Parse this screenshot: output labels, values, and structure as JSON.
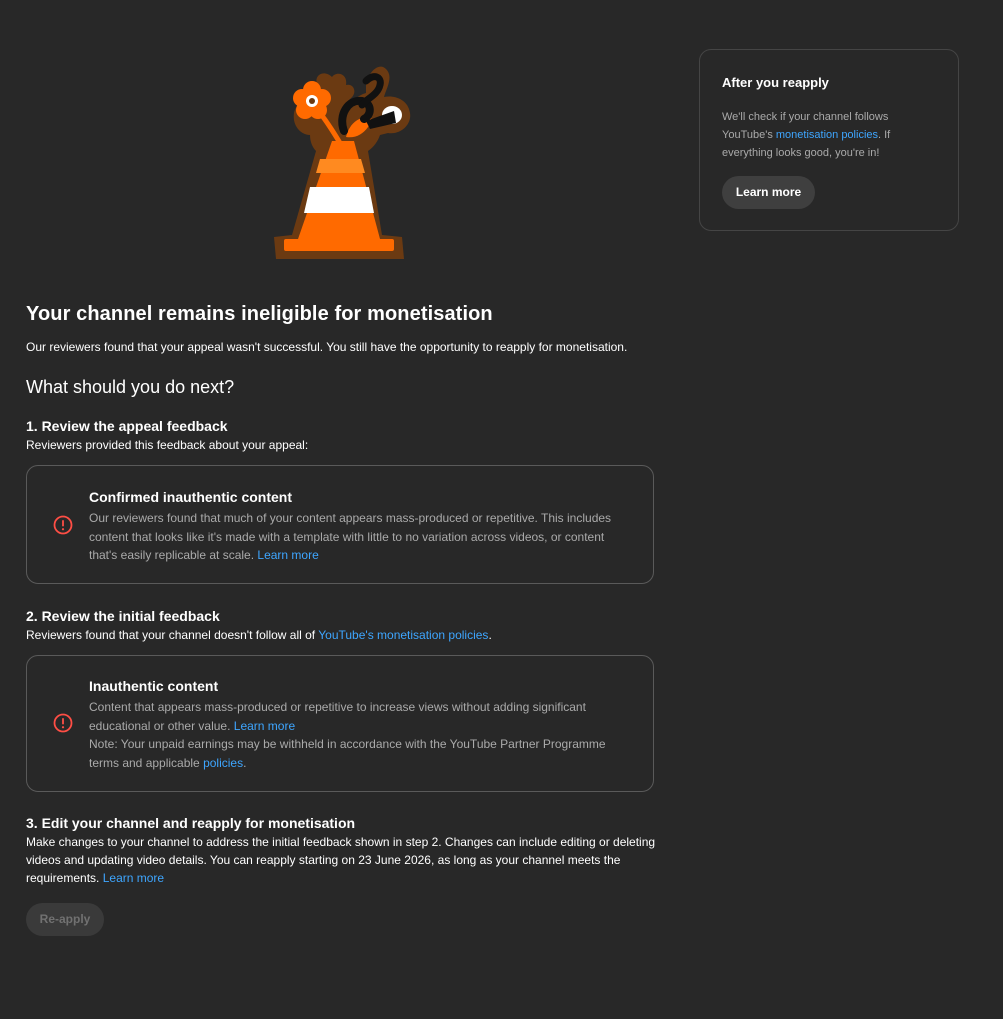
{
  "page": {
    "title": "Your channel remains ineligible for monetisation",
    "subtitle": "Our reviewers found that your appeal wasn't successful. You still have the opportunity to reapply for monetisation.",
    "next_heading": "What should you do next?"
  },
  "step1": {
    "title": "1. Review the appeal feedback",
    "desc": "Reviewers provided this feedback about your appeal:",
    "card": {
      "icon": "alert-circle-icon",
      "title": "Confirmed inauthentic content",
      "text": "Our reviewers found that much of your content appears mass-produced or repetitive. This includes content that looks like it's made with a template with little to no variation across videos, or content that's easily replicable at scale.",
      "link": "Learn more"
    }
  },
  "step2": {
    "title": "2. Review the initial feedback",
    "desc_prefix": "Reviewers found that your channel doesn't follow all of ",
    "desc_link": "YouTube's monetisation policies",
    "desc_suffix": ".",
    "card": {
      "icon": "alert-circle-icon",
      "title": "Inauthentic content",
      "text": "Content that appears mass-produced or repetitive to increase views without adding significant educational or other value.",
      "link": "Learn more",
      "note_prefix": "Note: Your unpaid earnings may be withheld in accordance with the YouTube Partner Programme terms and applicable ",
      "note_link": "policies",
      "note_suffix": "."
    }
  },
  "step3": {
    "title": "3. Edit your channel and reapply for monetisation",
    "desc": "Make changes to your channel to address the initial feedback shown in step 2. Changes can include editing or deleting videos and updating video details. You can reapply starting on 23 June 2026, as long as your channel meets the requirements.",
    "link": "Learn more",
    "button": "Re-apply"
  },
  "sidebar": {
    "title": "After you reapply",
    "text_prefix": "We'll check if your channel follows YouTube's ",
    "text_link": "monetisation policies",
    "text_suffix": ". If everything looks good, you're in!",
    "button": "Learn more"
  },
  "colors": {
    "background": "#282828",
    "link": "#3ea6ff",
    "alert": "#ff4e45",
    "cone_orange": "#ff6a00",
    "cone_outline": "#6b3a12"
  }
}
